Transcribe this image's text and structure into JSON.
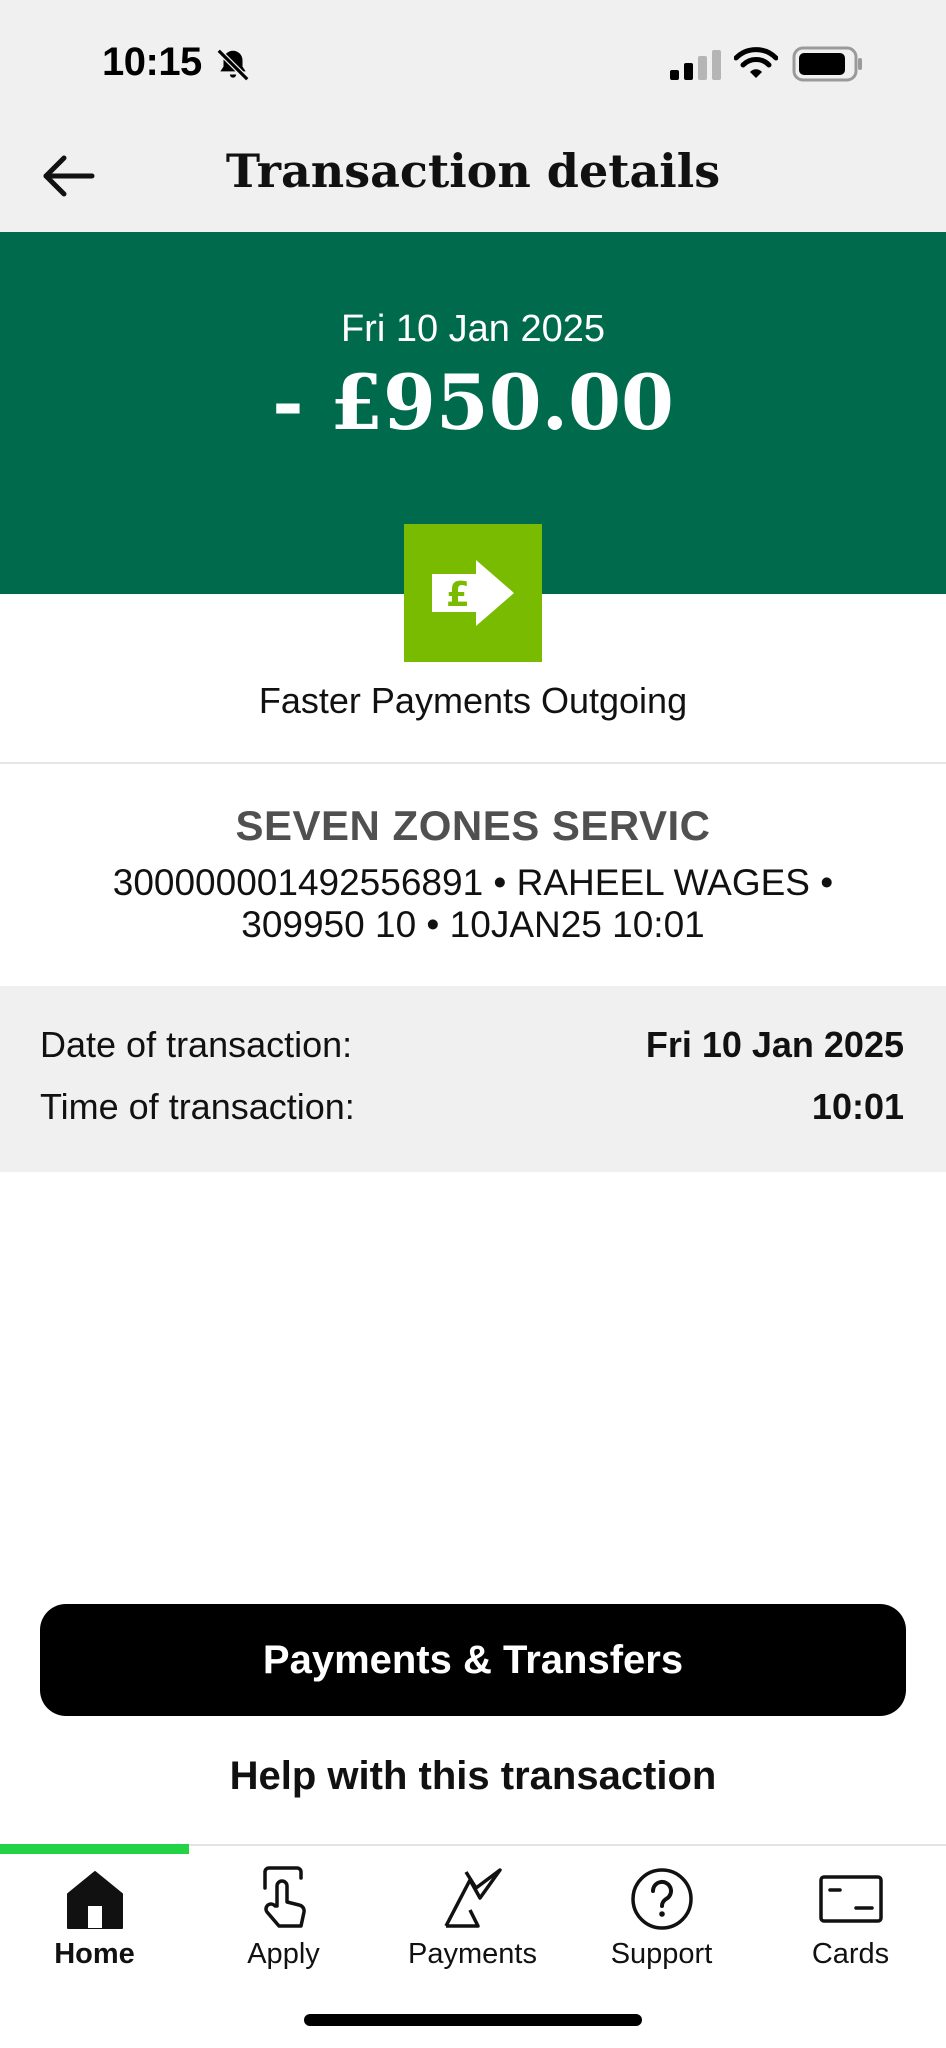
{
  "status_bar": {
    "time": "10:15"
  },
  "header": {
    "title": "Transaction details"
  },
  "hero": {
    "date": "Fri 10 Jan 2025",
    "amount": "- £950.00",
    "background_color": "#006a4d"
  },
  "payment_type": {
    "label": "Faster Payments Outgoing",
    "icon": "pound-arrow-icon",
    "icon_color": "#78bb00"
  },
  "merchant": {
    "name": "SEVEN ZONES SERVIC",
    "reference": "300000001492556891 • RAHEEL WAGES • 309950 10 • 10JAN25 10:01"
  },
  "details": {
    "date_label": "Date of transaction:",
    "date_value": "Fri 10 Jan 2025",
    "time_label": "Time of transaction:",
    "time_value": "10:01"
  },
  "actions": {
    "primary_label": "Payments & Transfers",
    "help_label": "Help with this transaction"
  },
  "tabs": [
    {
      "label": "Home",
      "icon": "home-icon",
      "active": true
    },
    {
      "label": "Apply",
      "icon": "tap-hand-icon",
      "active": false
    },
    {
      "label": "Payments",
      "icon": "payments-arrows-icon",
      "active": false
    },
    {
      "label": "Support",
      "icon": "question-circle-icon",
      "active": false
    },
    {
      "label": "Cards",
      "icon": "card-icon",
      "active": false
    }
  ],
  "accent_color": "#22d445"
}
